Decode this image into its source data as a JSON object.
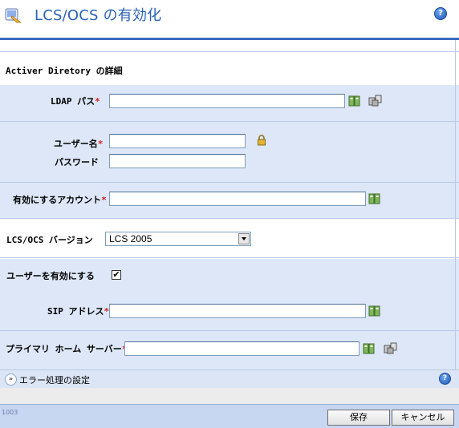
{
  "header": {
    "title": "LCS/OCS の有効化",
    "help": "?"
  },
  "section": {
    "title": "Activer Diretory の詳細"
  },
  "form": {
    "ldap": {
      "label": "LDAP パス",
      "value": ""
    },
    "username": {
      "label": "ユーザー名",
      "value": ""
    },
    "password": {
      "label": "パスワード",
      "value": ""
    },
    "account": {
      "label": "有効にするアカウント",
      "value": ""
    },
    "version": {
      "label": "LCS/OCS バージョン",
      "selected": "LCS 2005"
    },
    "enable_user": {
      "label": "ユーザーを有効にする",
      "checked": true,
      "mark": "✔"
    },
    "sip": {
      "label": "SIP アドレス",
      "value": ""
    },
    "home_server": {
      "label": "プライマリ ホーム サーバー",
      "value": ""
    },
    "required_mark": "*"
  },
  "error_section": {
    "label": "エラー処理の設定",
    "expand": "»",
    "help": "?"
  },
  "footer": {
    "page_no": "1003",
    "save": "保存",
    "cancel": "キャンセル"
  },
  "colors": {
    "title": "#2a63b8",
    "band": "#dde7f7",
    "required": "#d42020",
    "footer": "#c7d6f1"
  }
}
